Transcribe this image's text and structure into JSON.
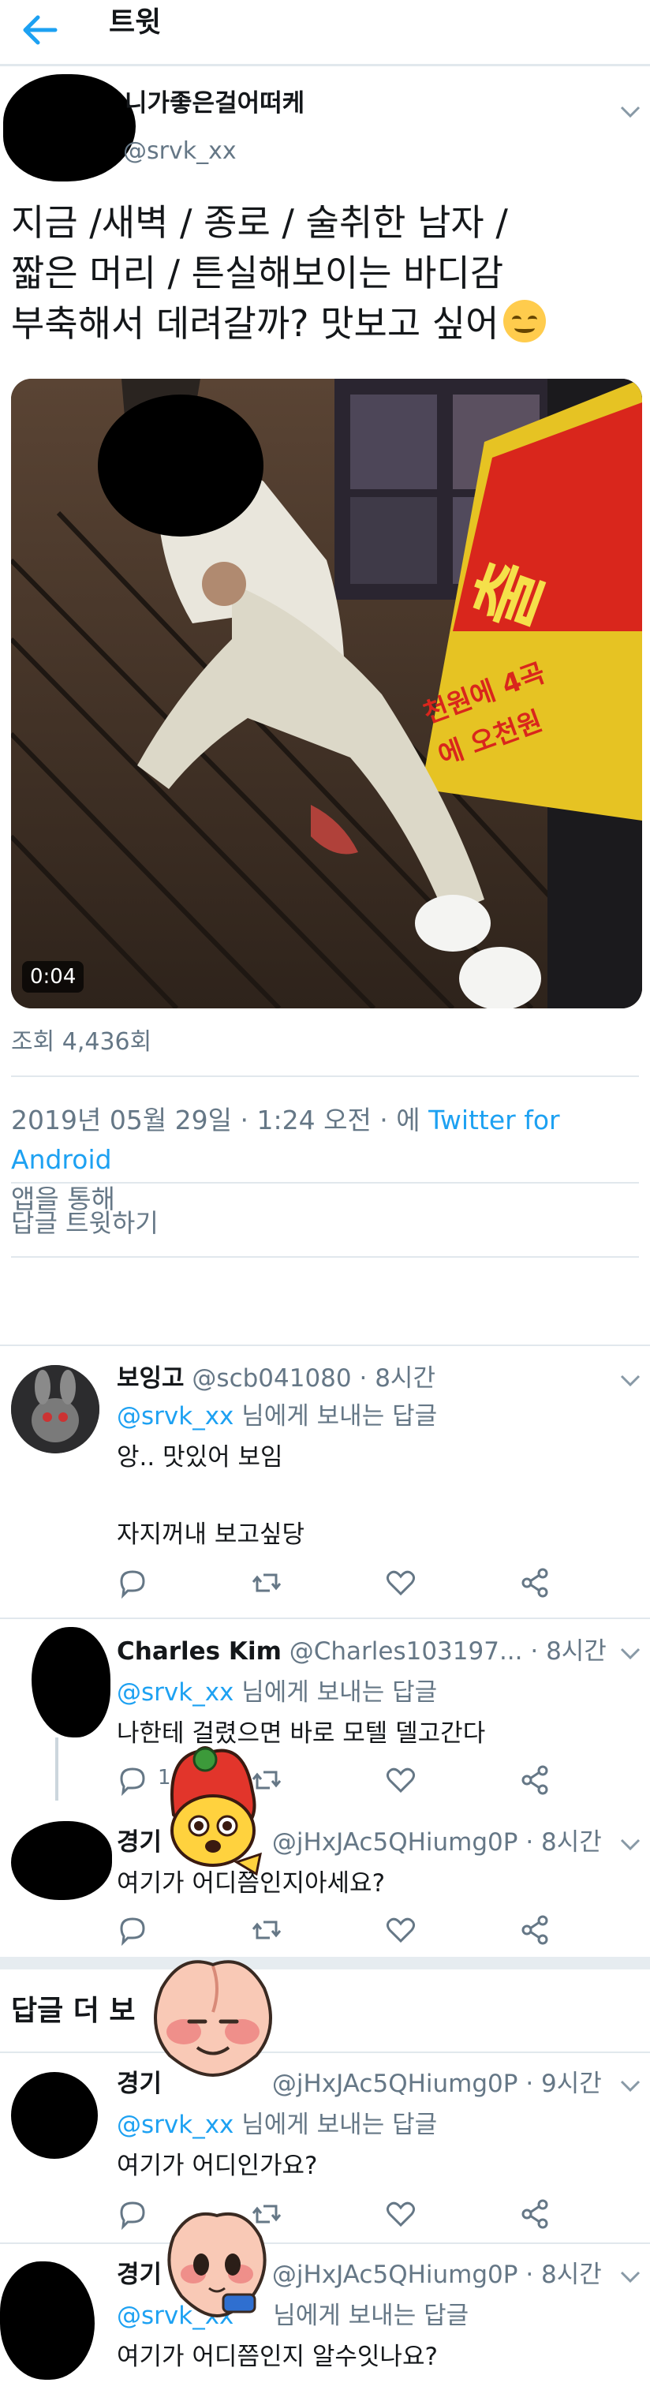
{
  "topbar": {
    "title": "트윗"
  },
  "author": {
    "name": "니가좋은걸어떠케",
    "handle": "@srvk_xx"
  },
  "tweet": {
    "line1": "지금 /새벽 / 종로 / 술취한 남자 /",
    "line2": "짧은 머리 / 튼실해보이는 바디감",
    "line3": "부축해서 데려갈까? 맛보고 싶어",
    "emoji": "grinning-face-emoji"
  },
  "video": {
    "duration": "0:04",
    "sign_text_1": "천원에 4곡",
    "sign_text_2": "에 오천원"
  },
  "views": "조회 4,436회",
  "meta": {
    "timestamp": "2019년 05월 29일 · 1:24 오전 · 에 ",
    "client": "Twitter for Android",
    "suffix": " 앱을 통해"
  },
  "reply_prompt": "답글 트윗하기",
  "more_replies": "답글 더 보",
  "colors": {
    "link": "#1da1f2",
    "secondary": "#657786",
    "divider": "#e1e8ed"
  },
  "replies": [
    {
      "name": "보잉고",
      "meta": "@scb041080 · 8시간",
      "replying_handle": "@srvk_xx",
      "replying_suffix": " 님에게 보내는 답글",
      "text1": "앙.. 맛있어 보임",
      "text2": "자지꺼내 보고싶당"
    },
    {
      "name": "Charles Kim",
      "meta": "@Charles103197... · 8시간",
      "replying_handle": "@srvk_xx",
      "replying_suffix": " 님에게 보내는 답글",
      "text1": "나한테 걸렸으면 바로 모텔 델고간다",
      "reply_count": "1"
    },
    {
      "name": "경기",
      "meta": "@jHxJAc5QHiumg0P · 8시간",
      "text1": "여기가 어디쯤인지아세요?"
    },
    {
      "name": "경기",
      "meta": "@jHxJAc5QHiumg0P · 9시간",
      "replying_handle": "@srvk_xx",
      "replying_suffix": " 님에게 보내는 답글",
      "text1": "여기가 어디인가요?"
    },
    {
      "name": "경기",
      "meta": "@jHxJAc5QHiumg0P · 8시간",
      "replying_handle": "@srvk_xx",
      "replying_suffix": " 님에게 보내는 답글",
      "text1": "여기가 어디쯤인지 알수잇나요?"
    }
  ]
}
